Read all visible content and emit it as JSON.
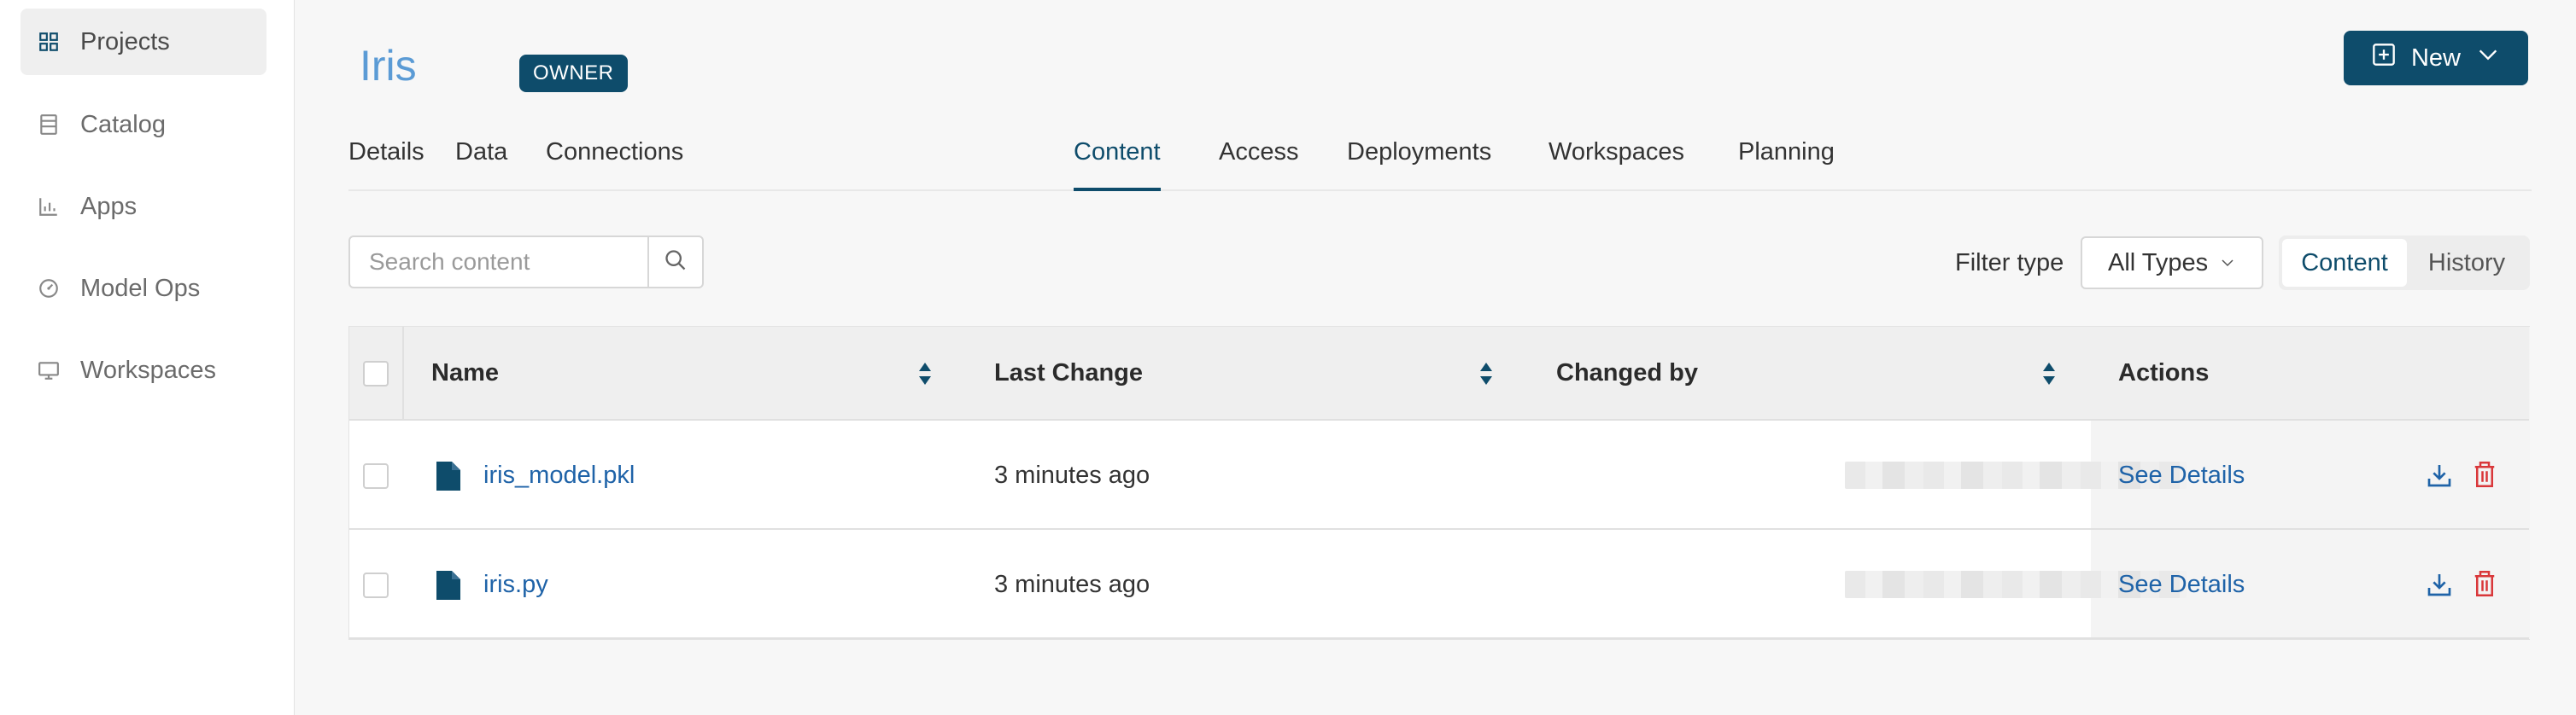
{
  "sidebar": {
    "items": [
      {
        "label": "Projects",
        "icon": "grid-icon",
        "active": true
      },
      {
        "label": "Catalog",
        "icon": "book-icon"
      },
      {
        "label": "Apps",
        "icon": "bar-chart-icon"
      },
      {
        "label": "Model Ops",
        "icon": "gauge-icon"
      },
      {
        "label": "Workspaces",
        "icon": "monitor-icon"
      }
    ]
  },
  "header": {
    "title": "Iris",
    "badge": "OWNER",
    "new_button": "New"
  },
  "tabs": [
    "Details",
    "Data",
    "Connections",
    "Content",
    "Access",
    "Deployments",
    "Workspaces",
    "Planning"
  ],
  "active_tab": "Content",
  "toolbar": {
    "search_placeholder": "Search content",
    "filter_label": "Filter type",
    "filter_value": "All Types",
    "view_toggle": [
      "Content",
      "History"
    ],
    "active_view": "Content"
  },
  "table": {
    "columns": [
      "Name",
      "Last Change",
      "Changed by",
      "Actions"
    ],
    "rows": [
      {
        "name": "iris_model.pkl",
        "last_change": "3 minutes ago",
        "changed_by": "",
        "action": "See Details"
      },
      {
        "name": "iris.py",
        "last_change": "3 minutes ago",
        "changed_by": "",
        "action": "See Details"
      }
    ]
  },
  "colors": {
    "accent": "#0e4c6b",
    "link": "#1f63a8",
    "title": "#5b9bd5",
    "delete": "#d9373a"
  }
}
